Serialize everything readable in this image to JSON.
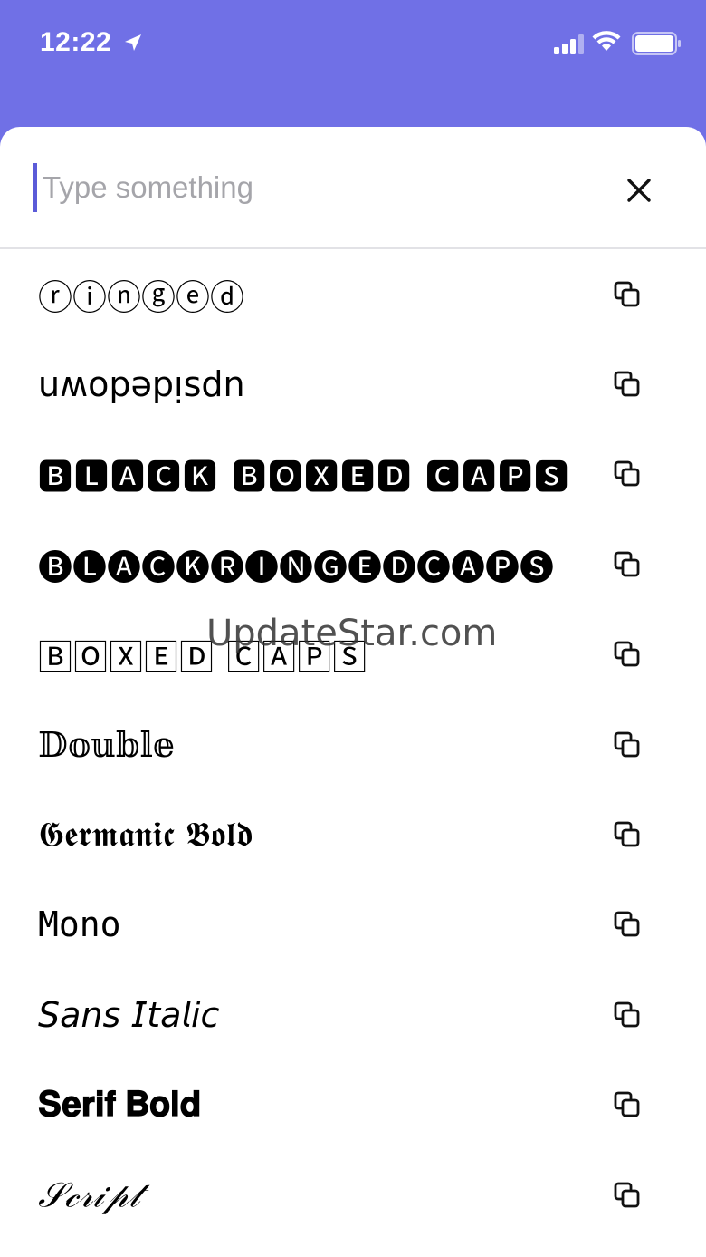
{
  "status_bar": {
    "time": "12:22",
    "location_icon": "location-arrow-icon",
    "signal_icon": "cellular-signal-icon",
    "wifi_icon": "wifi-icon",
    "battery_icon": "battery-icon"
  },
  "search": {
    "placeholder": "Type something",
    "value": "",
    "close_icon": "close-icon"
  },
  "styles": [
    {
      "name": "ringed",
      "sample": "ⓡⓘⓝⓖⓔⓓ"
    },
    {
      "name": "upsidedown",
      "sample": "uʍopǝpᴉsdn"
    },
    {
      "name": "black-boxed-caps",
      "sample": "🅱🅻🅰🅲🅺 🅱🅾🆇🅴🅳 🅲🅰🅿🆂"
    },
    {
      "name": "black-ringed-caps",
      "sample": "🅑🅛🅐🅒🅚🅡🅘🅝🅖🅔🅓🅒🅐🅟🅢"
    },
    {
      "name": "boxed-caps",
      "sample": "🄱🄾🅇🄴🄳 🄲🄰🄿🅂"
    },
    {
      "name": "double",
      "sample": "𝔻𝕠𝕦𝕓𝕝𝕖"
    },
    {
      "name": "germanic-bold",
      "sample": "𝕲𝖊𝖗𝖒𝖆𝖓𝖎𝖈 𝕭𝖔𝖑𝖉"
    },
    {
      "name": "mono",
      "sample": "𝙼𝚘𝚗𝚘"
    },
    {
      "name": "sans-italic",
      "sample": "𝘚𝘢𝘯𝘴 𝘐𝘵𝘢𝘭𝘪𝘤"
    },
    {
      "name": "serif-bold",
      "sample": "𝐒𝐞𝐫𝐢𝐟 𝐁𝐨𝐥𝐝"
    },
    {
      "name": "script",
      "sample": "𝒮𝒸𝓇𝒾𝓅𝓉"
    }
  ],
  "copy_icon": "copy-icon",
  "watermark": "UpdateStar.com",
  "colors": {
    "header": "#7070e6",
    "caret": "#5b5bd8",
    "placeholder": "#a5a5aa"
  }
}
